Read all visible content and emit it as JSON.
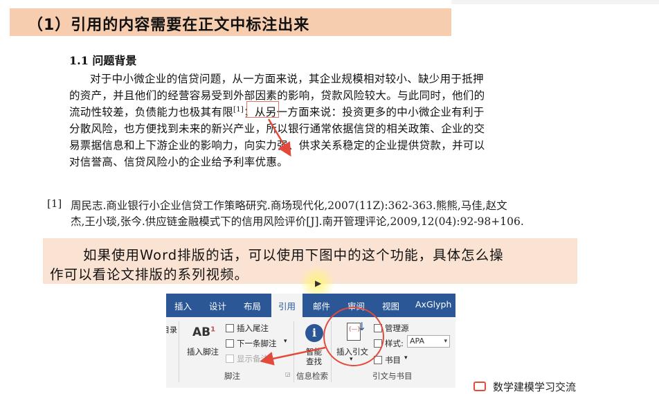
{
  "title": "（1）引用的内容需要在正文中标注出来",
  "document": {
    "section_heading": "1.1 问题背景",
    "paragraph_lines": [
      "对于中小微企业的信贷问题，从一方面来说，其企业规模相对较小、缺少用于抵押",
      "的资产，并且他们的经营容易受到外部因素的影响，贷款风险较大。与此同时，他们的",
      "流动性较差，负债能力也极其有限",
      "[1]",
      "；从另一方面来说：投资更多的中小微企业有利于",
      "分散风险，也方便找到未来的新兴产业，所以银行通常依据信贷的相关政策、企业的交",
      "易票据信息和上下游企业的影响力，向实力强、供求关系稳定的企业提供贷款，并可以",
      "对信誉高、信贷风险小的企业给予利率优惠。"
    ],
    "reference_number": "[1]",
    "reference_lines": [
      "周民志.商业银行小企业信贷工作策略研究.商场现代化,2007(11Z):362-363.熊熊,马佳,赵文",
      "杰,王小琰,张今.供应链金融模式下的信用风险评价[J].南开管理评论,2009,12(04):92-98+106."
    ]
  },
  "note": {
    "line1": "如果使用Word排版的话，可以使用下图中的这个功能，具体怎么操",
    "line2": "作可以看论文排版的系列视频。"
  },
  "ribbon": {
    "tabs": [
      "插入",
      "设计",
      "布局",
      "引用",
      "邮件",
      "审阅",
      "视图",
      "AxGlyph"
    ],
    "active_tab": "引用",
    "insert_footnote_icon": "AB",
    "insert_footnote": "插入脚注",
    "insert_endnote": "插入尾注",
    "next_footnote": "下一条脚注",
    "show_notes": "显示备注",
    "footnote_group": "脚注",
    "smart_lookup_line1": "智能",
    "smart_lookup_line2": "查找",
    "research_group": "信息检索",
    "insert_citation": "插入引文",
    "manage_sources": "管理源",
    "style_label": "样式:",
    "style_value": "APA",
    "bibliography": "书目",
    "citations_group": "引文与书目",
    "left_cut_text": "目录"
  },
  "bottom_right_text": "数学建模学习交流",
  "colors": {
    "title_band": "#f7cdb0",
    "note_band": "#fbe3d3",
    "ribbon_tabbar": "#2b5797",
    "annotation_red": "#e34a3c"
  }
}
